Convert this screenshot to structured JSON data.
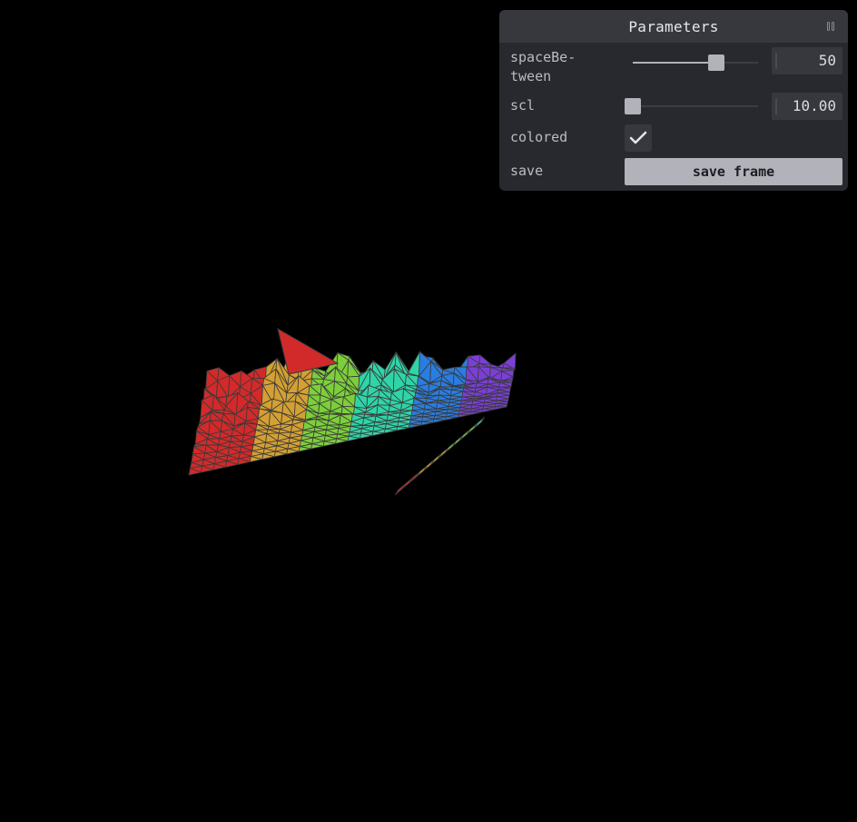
{
  "panel": {
    "title": "Parameters",
    "collapse_icon": "collapse-icon",
    "controls": [
      {
        "name": "spaceBetween",
        "label": "spaceBe-\ntween",
        "type": "slider",
        "value": "50",
        "fraction": 0.67
      },
      {
        "name": "scl",
        "label": "scl",
        "type": "slider",
        "value": "10.00",
        "fraction": 0.0
      },
      {
        "name": "colored",
        "label": "colored",
        "type": "checkbox",
        "checked": true
      },
      {
        "name": "save",
        "label": "save",
        "type": "button",
        "button_label": "save frame"
      }
    ]
  },
  "colors": {
    "background": "#000000",
    "panel_bg": "#28292e",
    "accent": "#b2b3ba",
    "mesh_palette": [
      "#d22a2a",
      "#d4a032",
      "#7ccf3a",
      "#2fd4a8",
      "#2a7de0",
      "#7b3fd6"
    ]
  }
}
